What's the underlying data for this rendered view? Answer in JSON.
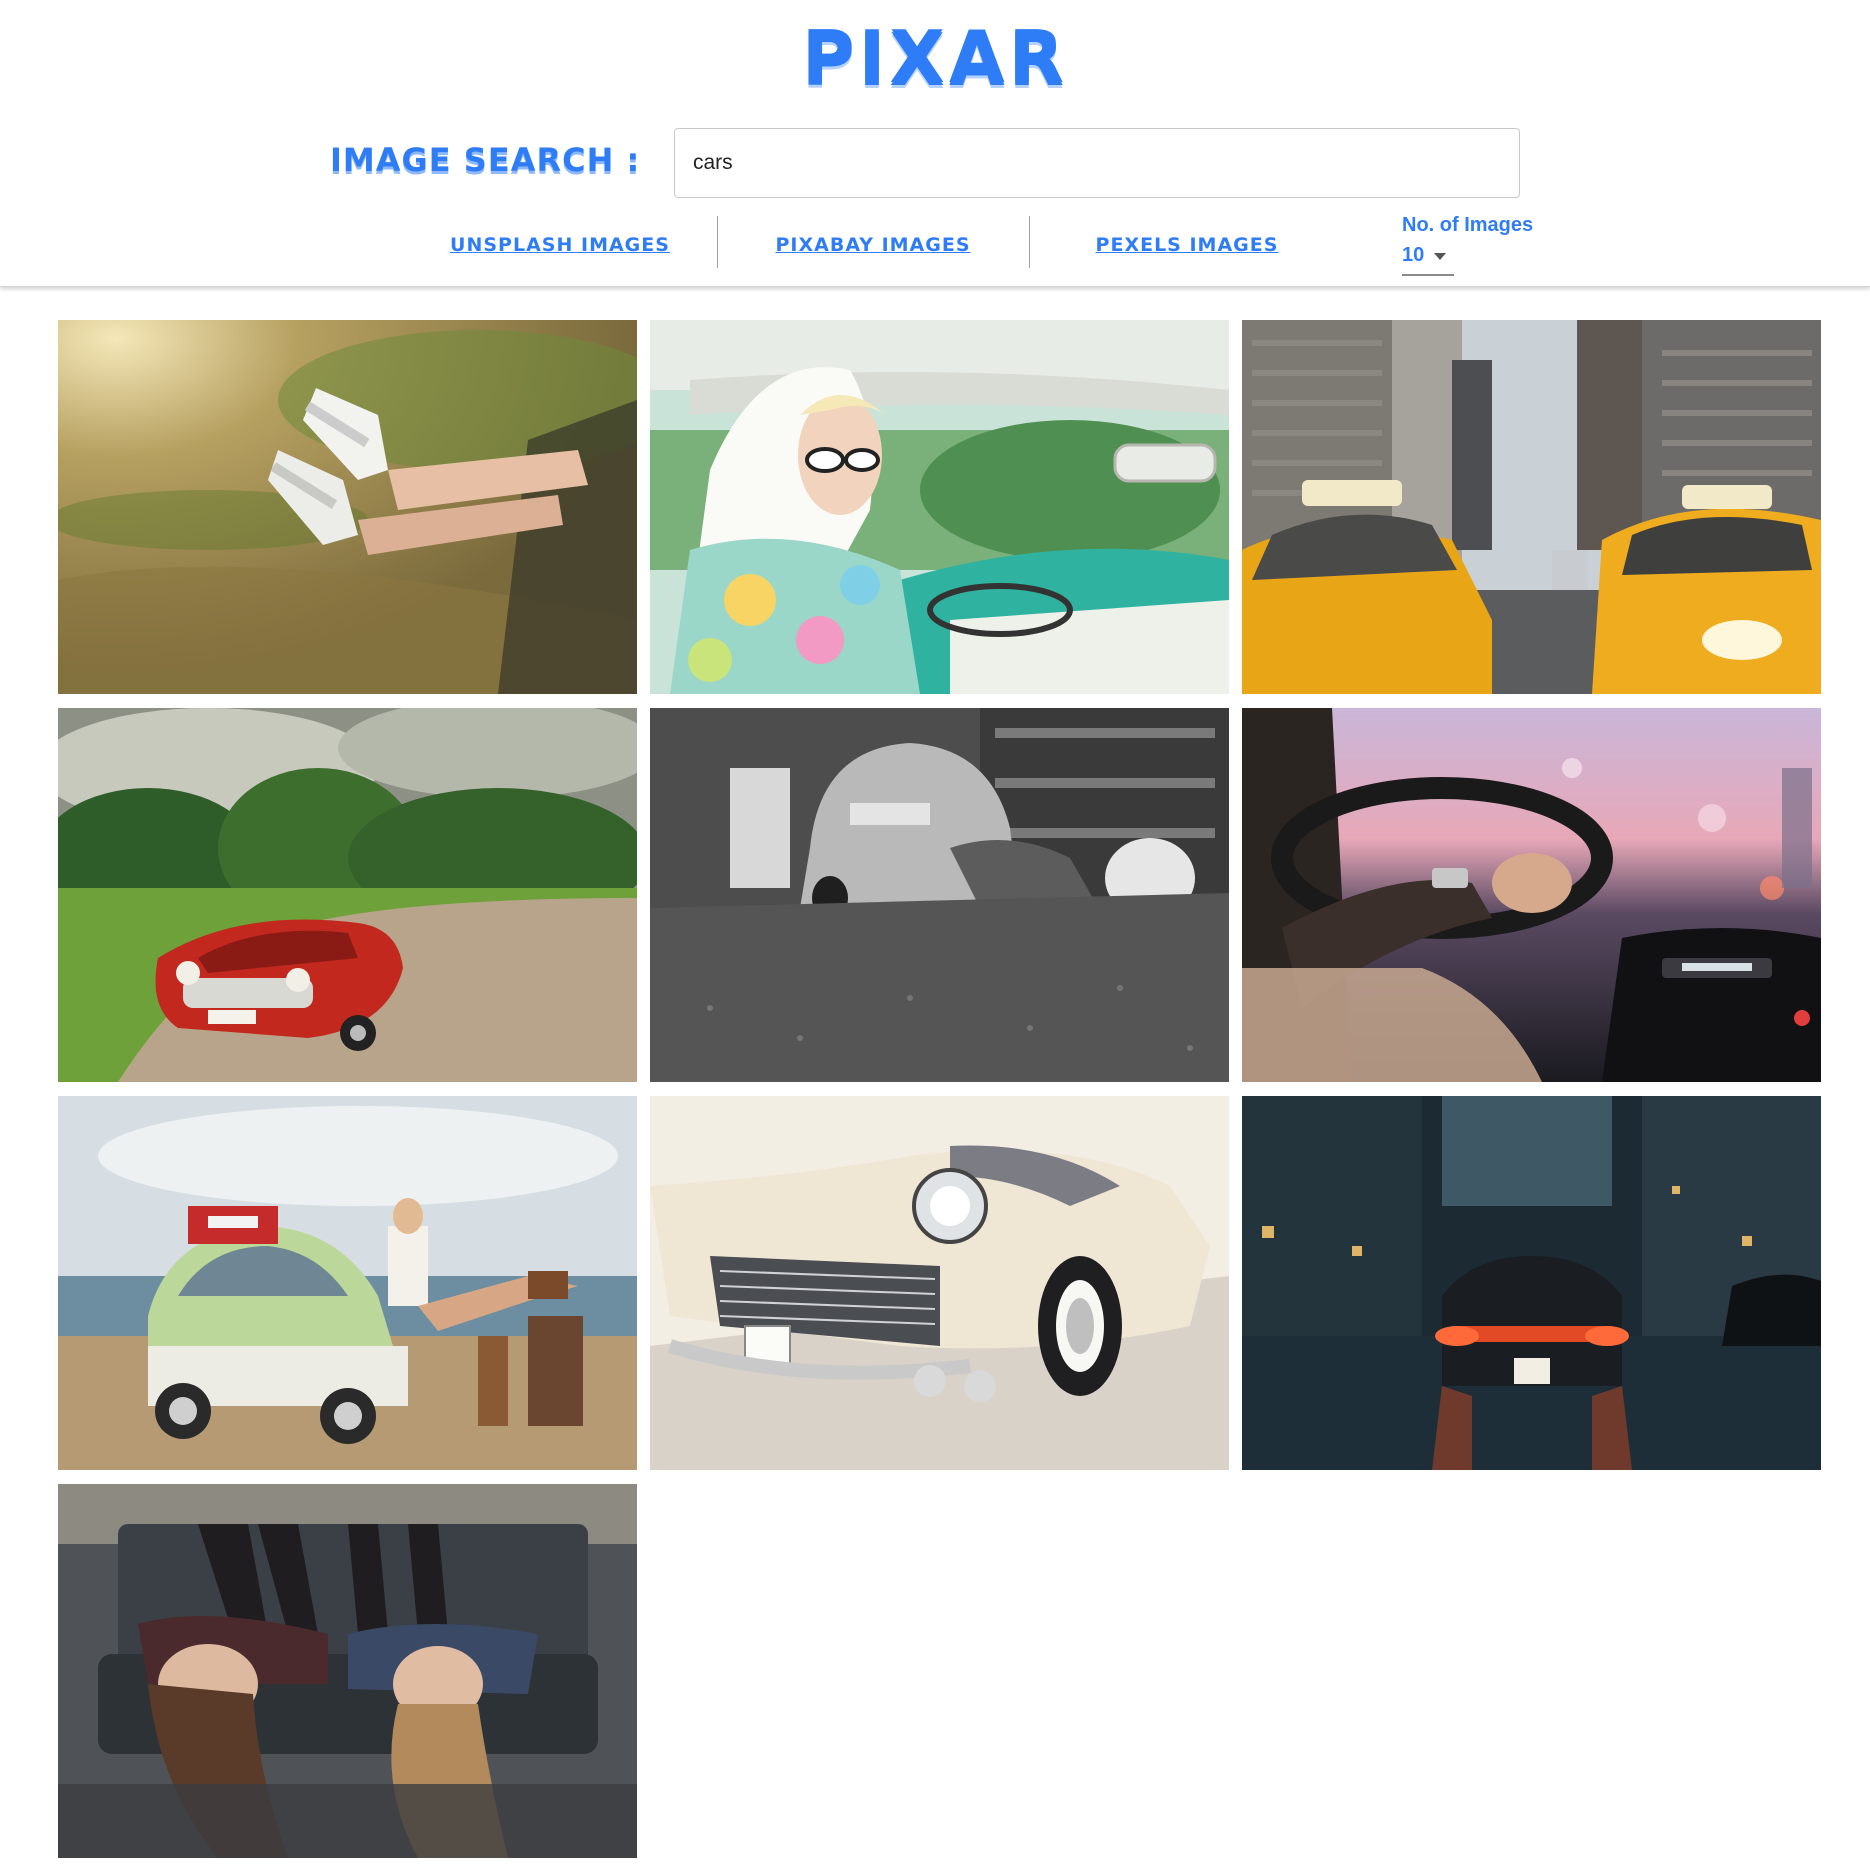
{
  "header": {
    "logo": "PIXAR",
    "search_label": "IMAGE SEARCH :",
    "search_value": "cars",
    "sources": [
      "UNSPLASH IMAGES",
      "PIXABAY IMAGES",
      "PEXELS IMAGES"
    ],
    "count_label": "No. of Images",
    "count_value": "10"
  },
  "colors": {
    "accent": "#2f7df6"
  },
  "results": [
    {
      "subject": "sneakers out of car window"
    },
    {
      "subject": "woman driving vintage car"
    },
    {
      "subject": "yellow taxis in city street"
    },
    {
      "subject": "red vintage convertible on dirt road"
    },
    {
      "subject": "mechanic under beetle in garage"
    },
    {
      "subject": "hands on steering wheel at dusk"
    },
    {
      "subject": "green beetle at the beach"
    },
    {
      "subject": "classic cadillac front"
    },
    {
      "subject": "sports car on wet city street"
    },
    {
      "subject": "two women lying on truck hood"
    }
  ]
}
